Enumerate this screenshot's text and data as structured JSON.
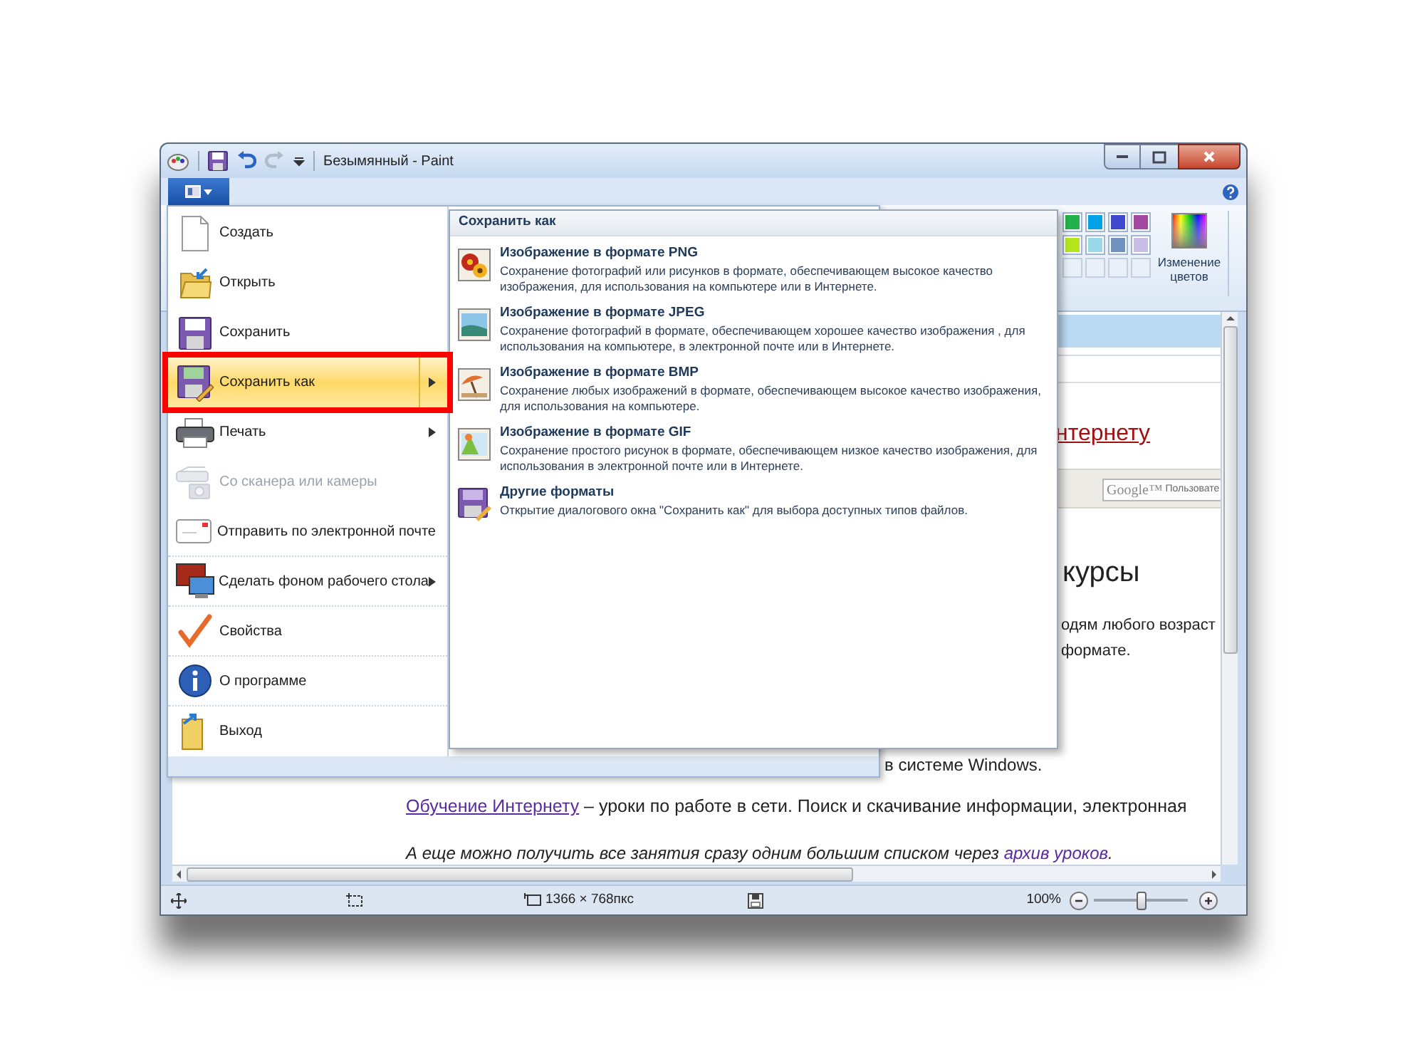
{
  "window": {
    "title": "Безымянный - Paint"
  },
  "quick_access": [
    {
      "kind": "save",
      "disabled": false
    },
    {
      "kind": "undo",
      "disabled": false
    },
    {
      "kind": "redo",
      "disabled": true
    }
  ],
  "palette": {
    "colors": [
      {
        "color": "#22b14c"
      },
      {
        "color": "#00a2e8"
      },
      {
        "color": "#3f48cc"
      },
      {
        "color": "#a349a4"
      },
      {
        "color": "#b5e61d"
      },
      {
        "color": "#99d9ea"
      },
      {
        "color": "#7092be"
      },
      {
        "color": "#c8bfe7"
      }
    ]
  },
  "edit_colors_button": {
    "label": "Изменение цветов"
  },
  "file_menu": {
    "items": [
      {
        "kind": "new",
        "label": "Создать",
        "submenu": false,
        "disabled": false,
        "selected": false,
        "separator_after": false
      },
      {
        "kind": "open",
        "label": "Открыть",
        "submenu": false,
        "disabled": false,
        "selected": false,
        "separator_after": false
      },
      {
        "kind": "save",
        "label": "Сохранить",
        "submenu": false,
        "disabled": false,
        "selected": false,
        "separator_after": false
      },
      {
        "kind": "save_as",
        "label": "Сохранить как",
        "submenu": true,
        "disabled": false,
        "selected": true,
        "separator_after": false
      },
      {
        "kind": "print",
        "label": "Печать",
        "submenu": true,
        "disabled": false,
        "selected": false,
        "separator_after": false
      },
      {
        "kind": "scanner",
        "label": "Со сканера или камеры",
        "submenu": false,
        "disabled": true,
        "selected": false,
        "separator_after": false
      },
      {
        "kind": "email",
        "label": "Отправить по электронной почте",
        "submenu": false,
        "disabled": false,
        "selected": false,
        "separator_after": true
      },
      {
        "kind": "wallpaper",
        "label": "Сделать фоном рабочего стола",
        "submenu": true,
        "disabled": false,
        "selected": false,
        "separator_after": true
      },
      {
        "kind": "properties",
        "label": "Свойства",
        "submenu": false,
        "disabled": false,
        "selected": false,
        "separator_after": true
      },
      {
        "kind": "about",
        "label": "О программе",
        "submenu": false,
        "disabled": false,
        "selected": false,
        "separator_after": true
      },
      {
        "kind": "exit",
        "label": "Выход",
        "submenu": false,
        "disabled": false,
        "selected": false,
        "separator_after": false
      }
    ]
  },
  "save_as_menu": {
    "title": "Сохранить как",
    "items": [
      {
        "kind": "png",
        "title": "Изображение в формате PNG",
        "description": "Сохранение фотографий или рисунков в формате, обеспечивающем высокое качество изображения, для использования на компьютере или в Интернете."
      },
      {
        "kind": "jpeg",
        "title": "Изображение в формате JPEG",
        "description": "Сохранение фотографий в формате, обеспечивающем хорошее качество изображения , для использования на компьютере, в электронной почте или в Интернете."
      },
      {
        "kind": "bmp",
        "title": "Изображение в формате BMP",
        "description": "Сохранение любых изображений в формате, обеспечивающем высокое качество изображения, для использования на компьютере."
      },
      {
        "kind": "gif",
        "title": "Изображение в формате GIF",
        "description": "Сохранение простого рисунок в формате, обеспечивающем низкое качество изображения, для использования в электронной почте или в Интернете."
      },
      {
        "kind": "other",
        "title": "Другие форматы",
        "description": "Открытие диалогового окна \"Сохранить как\" для выбора доступных типов файлов."
      }
    ]
  },
  "canvas": {
    "link_fragment": "нтернету",
    "search_field": {
      "logo": "Google™",
      "placeholder": "Пользовате"
    },
    "heading_fragment": "курсы",
    "paragraph_lines": [
      "одям любого возраст",
      "формате."
    ],
    "covered_line": "в системе Windows.",
    "lesson_paragraph": {
      "link": "Обучение Интернету",
      "text": " – уроки по работе в сети. Поиск и скачивание информации, электронная"
    },
    "note": {
      "text": "А еще можно получить все занятия сразу одним большим списком через ",
      "link": "архив уроков",
      "end": "."
    }
  },
  "status_bar": {
    "dimensions": "1366 × 768пкс",
    "zoom": "100%",
    "zoom_slider": {
      "level": 0.5
    }
  }
}
